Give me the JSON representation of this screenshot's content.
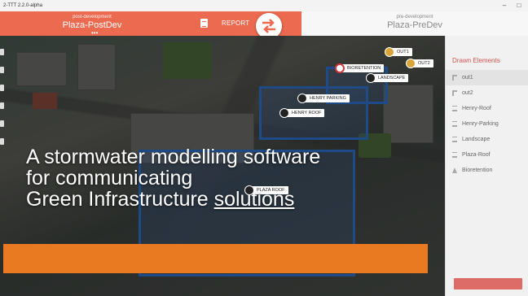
{
  "window": {
    "title": "2-TTT 2.2.0-alpha",
    "minimize": "–",
    "restore": "□"
  },
  "left_scenario": {
    "subtitle": "post-development",
    "name": "Plaza-PostDev",
    "menu": "•••"
  },
  "report": {
    "label": "REPORT",
    "icon": "document-icon"
  },
  "swap": {
    "icon": "swap-arrows-icon"
  },
  "right_scenario": {
    "subtitle": "pre-development",
    "name": "Plaza-PreDev"
  },
  "map": {
    "markers": [
      {
        "label": "OUT1",
        "kind": "outlet"
      },
      {
        "label": "OUT2",
        "kind": "outlet"
      },
      {
        "label": "BIORETENTION",
        "kind": "bioretention"
      },
      {
        "label": "LANDSCAPE",
        "kind": "landscape"
      },
      {
        "label": "HENRY PARKING",
        "kind": "surface"
      },
      {
        "label": "HENRY ROOF",
        "kind": "roof"
      },
      {
        "label": "PLAZA ROOF",
        "kind": "roof"
      }
    ]
  },
  "headline": {
    "line1": "A stormwater modelling software",
    "line2": "for communicating",
    "line3_start": "Green Infrastructure ",
    "line3_underlined": "solutions"
  },
  "sidebar": {
    "heading": "Drawn Elements",
    "items": [
      {
        "label": "out1",
        "icon": "outlet-icon"
      },
      {
        "label": "out2",
        "icon": "outlet-icon"
      },
      {
        "label": "Henry-Roof",
        "icon": "roof-icon"
      },
      {
        "label": "Henry-Parking",
        "icon": "roof-icon"
      },
      {
        "label": "Landscape",
        "icon": "roof-icon"
      },
      {
        "label": "Plaza-Roof",
        "icon": "roof-icon"
      },
      {
        "label": "Bioretention",
        "icon": "bioretention-icon"
      }
    ]
  },
  "colors": {
    "accent": "#ec6a50",
    "orange_bar": "#ea7a22",
    "polygon": "#2f74d0",
    "sidebar_heading": "#d9534f"
  }
}
